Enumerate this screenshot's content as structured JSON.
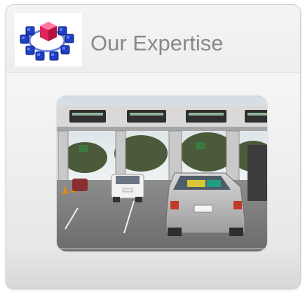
{
  "card": {
    "title": "Our Expertise"
  },
  "icons": {
    "logo": "cube-network-logo-icon"
  },
  "photo": {
    "toll_signs": [
      "",
      "",
      "",
      "",
      ""
    ]
  },
  "colors": {
    "title_text": "#888888",
    "card_background": "#f2f2f2",
    "logo_blue": "#1f3fc4",
    "logo_red": "#e0245e"
  }
}
